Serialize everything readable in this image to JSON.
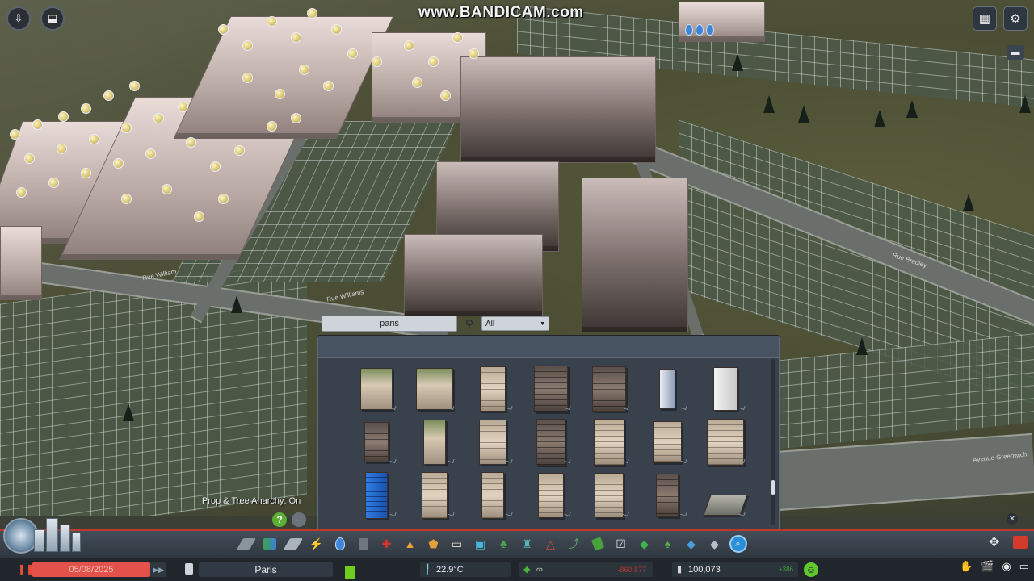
{
  "watermark": "www.BANDICAM.com",
  "top_left": {
    "left_btn_icon": "download-arrow-icon",
    "right_btn_icon": "unlock-icon"
  },
  "top_right": {
    "map_icon": "city-map-icon",
    "settings_icon": "gear-icon",
    "screenshot_icon": "camera-icon"
  },
  "street_labels": [
    "Rue William",
    "Rue Williams",
    "Rue Bradley",
    "Avenue Greenwich"
  ],
  "asset_panel": {
    "search_value": "paris",
    "filter_value": "All",
    "filter_caret": "▼",
    "asset_rows": [
      [
        "paris-building",
        "paris-building",
        "paris-building",
        "paris-building",
        "paris-building",
        "paris-building",
        "paris-building"
      ],
      [
        "paris-building",
        "paris-building",
        "paris-building",
        "paris-building",
        "paris-building",
        "paris-building",
        "paris-building"
      ],
      [
        "paris-building",
        "paris-building",
        "paris-building",
        "paris-building",
        "paris-building",
        "paris-building",
        "paris-building"
      ]
    ]
  },
  "anarchy_label": "Prop & Tree Anarchy: On",
  "help_label": "?",
  "minus_label": "−",
  "close_label": "✕",
  "status": {
    "date": "05/08/2025",
    "city_name": "Paris",
    "temperature": "22.9°C",
    "infinity": "∞",
    "money_delta": "-860,877",
    "money": "100,073",
    "money_income": "+386"
  },
  "colors": {
    "accent_red": "#c0392b",
    "date_bg": "#e2524a",
    "happy_green": "#5fc82c",
    "panel_bg": "#38414c"
  }
}
